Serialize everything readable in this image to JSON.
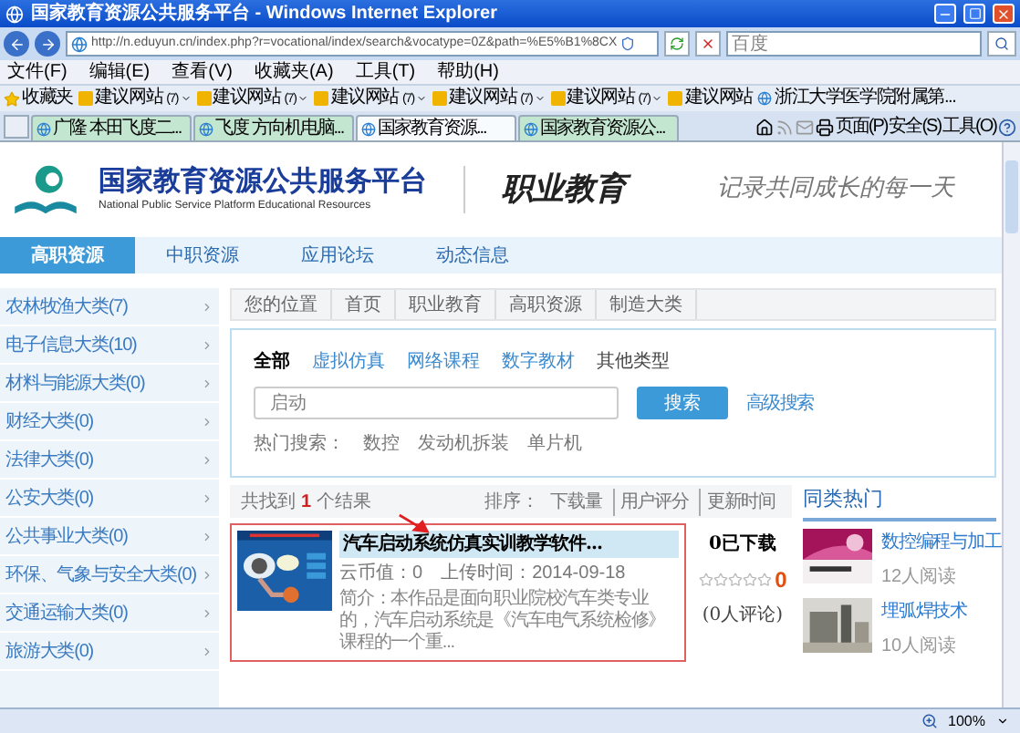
{
  "window": {
    "title": "国家教育资源公共服务平台 - Windows Internet Explorer"
  },
  "address_bar": {
    "url": "http://n.eduyun.cn/index.php?r=vocational/index/search&vocatype=0Z&path=%E5%B1%8CX",
    "search_placeholder": "百度"
  },
  "menu": [
    "文件(F)",
    "编辑(E)",
    "查看(V)",
    "收藏夹(A)",
    "工具(T)",
    "帮助(H)"
  ],
  "favorites_bar": {
    "label": "收藏夹",
    "links": [
      {
        "kind": "suggested",
        "label": "建议网站",
        "count": "(7)"
      },
      {
        "kind": "suggested",
        "label": "建议网站",
        "count": "(7)"
      },
      {
        "kind": "suggested",
        "label": "建议网站",
        "count": "(7)"
      },
      {
        "kind": "suggested",
        "label": "建议网站",
        "count": "(7)"
      },
      {
        "kind": "suggested",
        "label": "建议网站",
        "count": "(7)"
      },
      {
        "kind": "suggested",
        "label": "建议网站"
      },
      {
        "kind": "page",
        "label": "浙江大学医学院附属第..."
      }
    ]
  },
  "tabs": [
    {
      "label": "广隆 本田飞度二...",
      "selected": false
    },
    {
      "label": "飞度 方向机电脑...",
      "selected": false
    },
    {
      "label": "国家教育资源...",
      "selected": true
    },
    {
      "label": "国家教育资源公...",
      "selected": false
    }
  ],
  "command_bar": [
    "页面(P)",
    "安全(S)",
    "工具(O)"
  ],
  "site": {
    "title": "国家教育资源公共服务平台",
    "subtitle": "National Public Service Platform Educational Resources",
    "section": "职业教育",
    "slogan": "记录共同成长的每一天"
  },
  "nav": [
    {
      "label": "高职资源",
      "selected": true
    },
    {
      "label": "中职资源",
      "selected": false
    },
    {
      "label": "应用论坛",
      "selected": false
    },
    {
      "label": "动态信息",
      "selected": false
    }
  ],
  "categories": [
    "农林牧渔大类(7)",
    "电子信息大类(10)",
    "材料与能源大类(0)",
    "财经大类(0)",
    "法律大类(0)",
    "公安大类(0)",
    "公共事业大类(0)",
    "环保、气象与安全大类(0)",
    "交通运输大类(0)",
    "旅游大类(0)"
  ],
  "breadcrumb": [
    "您的位置",
    "首页",
    "职业教育",
    "高职资源",
    "制造大类"
  ],
  "search": {
    "types": [
      {
        "label": "全部",
        "selected": true
      },
      {
        "label": "虚拟仿真",
        "selected": false
      },
      {
        "label": "网络课程",
        "selected": false
      },
      {
        "label": "数字教材",
        "selected": false
      },
      {
        "label": "其他类型",
        "selected": false
      }
    ],
    "placeholder": "启动",
    "button": "搜索",
    "advanced": "高级搜索",
    "hot_label": "热门搜索：",
    "hot_terms": [
      "数控",
      "发动机拆装",
      "单片机"
    ]
  },
  "results_bar": {
    "prefix": "共找到",
    "count": "1",
    "suffix": "个结果",
    "sort_label": "排序：",
    "sort_options": [
      "下载量",
      "用户评分",
      "更新时间"
    ]
  },
  "results": [
    {
      "title": "汽车启动系统仿真实训教学软件...",
      "coins": "云币值：0",
      "upload": "上传时间：2014-09-18",
      "intro": "简介：本作品是面向职业院校汽车类专业的，汽车启动系统是《汽车电气系统检修》课程的一个重...",
      "downloads": "0已下载",
      "stars": 0,
      "score": "0",
      "comments": "(0人评论)"
    }
  ],
  "hot": {
    "title": "同类热门",
    "items": [
      {
        "title": "数控编程与加工",
        "reads": "12人阅读"
      },
      {
        "title": "埋弧焊技术",
        "reads": "10人阅读"
      }
    ]
  },
  "status_bar": {
    "zoom": "100%"
  }
}
